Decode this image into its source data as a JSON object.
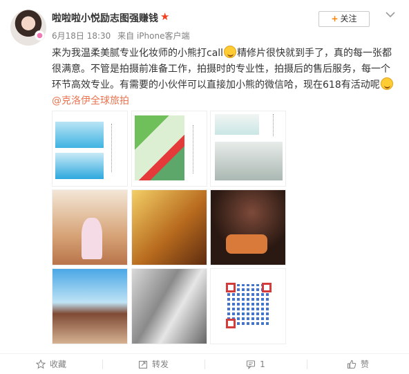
{
  "user": {
    "name": "啦啦啦小悦励志图强赚钱",
    "date": "6月18日 18:30",
    "source": "来自 iPhone客户端"
  },
  "follow_label": "关注",
  "post": {
    "text_part1": "来为我温柔美腻专业化妆师的小熊打call",
    "text_part2": "精修片很快就到手了，真的每一张都很满意。不管是拍摄前准备工作，拍摄时的专业性，拍摄后的售后服务，每一个环节高效专业。有需要的小伙伴可以直接加小熊的微信哈，现在618有活动呢",
    "mention": "@克洛伊全球旅拍"
  },
  "actions": {
    "favorite": "收藏",
    "repost": "转发",
    "comment": "1",
    "like": "赞"
  },
  "colors": {
    "accent": "#ff8200",
    "link": "#eb7350",
    "vip": "#f04020"
  }
}
